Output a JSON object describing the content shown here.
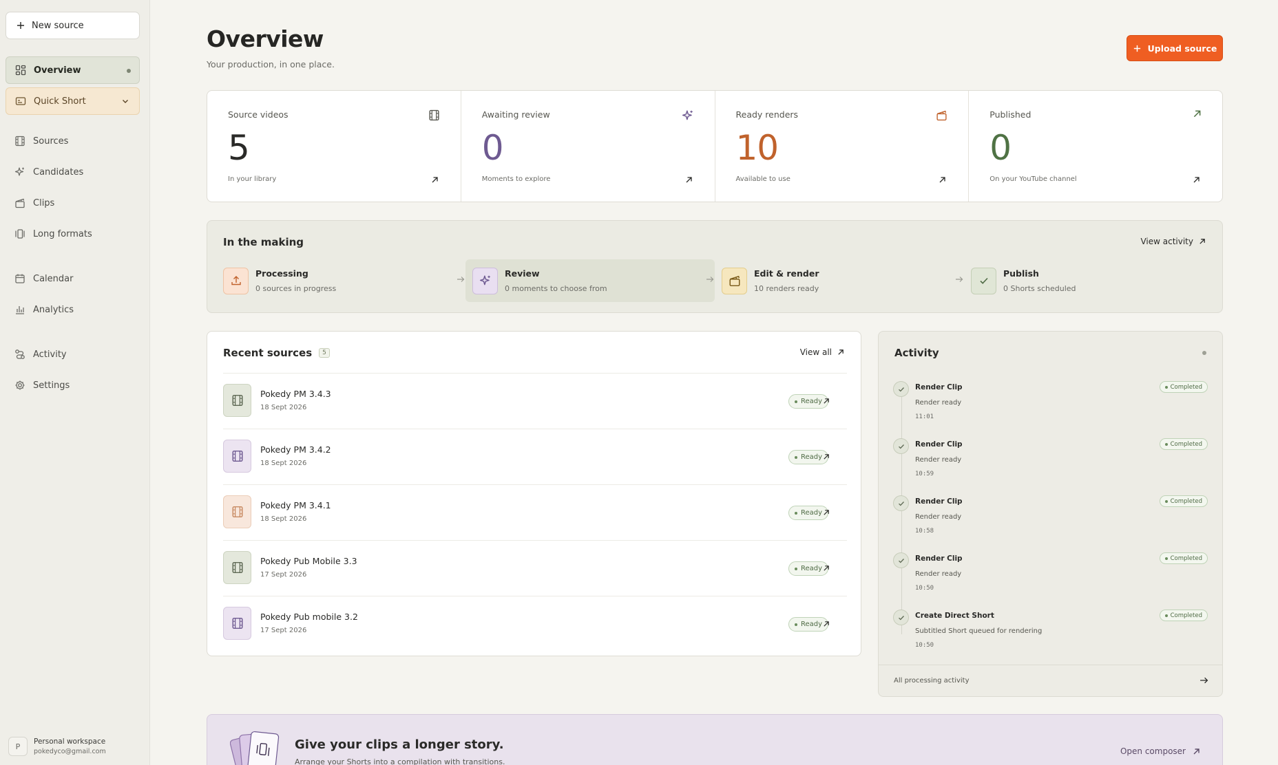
{
  "sidebar": {
    "new_source": "New source",
    "items": [
      {
        "label": "Overview"
      },
      {
        "label": "Quick Short"
      },
      {
        "label": "Sources"
      },
      {
        "label": "Candidates"
      },
      {
        "label": "Clips"
      },
      {
        "label": "Long formats"
      },
      {
        "label": "Calendar"
      },
      {
        "label": "Analytics"
      },
      {
        "label": "Activity"
      },
      {
        "label": "Settings"
      }
    ],
    "workspace": {
      "avatar": "P",
      "name": "Personal workspace",
      "email": "pokedyco@gmail.com"
    }
  },
  "header": {
    "title": "Overview",
    "subtitle": "Your production, in one place.",
    "upload_label": "Upload source"
  },
  "stats": [
    {
      "label": "Source videos",
      "value": "5",
      "sub": "In your library",
      "icon": "film-icon",
      "color": "#2a2a28"
    },
    {
      "label": "Awaiting review",
      "value": "0",
      "sub": "Moments to explore",
      "icon": "sparkle-icon",
      "color": "#6e5a91"
    },
    {
      "label": "Ready renders",
      "value": "10",
      "sub": "Available to use",
      "icon": "clapper-icon",
      "color": "#c0622c"
    },
    {
      "label": "Published",
      "value": "0",
      "sub": "On your YouTube channel",
      "icon": "arrow-up-right-icon",
      "color": "#4f7244"
    }
  ],
  "making": {
    "title": "In the making",
    "view_activity": "View activity",
    "stages": [
      {
        "title": "Processing",
        "sub": "0 sources in progress",
        "icon": "upload-icon"
      },
      {
        "title": "Review",
        "sub": "0 moments to choose from",
        "icon": "sparkle-icon"
      },
      {
        "title": "Edit & render",
        "sub": "10 renders ready",
        "icon": "clapper-icon"
      },
      {
        "title": "Publish",
        "sub": "0 Shorts scheduled",
        "icon": "check-icon"
      }
    ]
  },
  "recent": {
    "title": "Recent sources",
    "count": "5",
    "view_all": "View all",
    "items": [
      {
        "name": "Pokedy PM 3.4.3",
        "date": "18 Sept 2026",
        "status": "Ready"
      },
      {
        "name": "Pokedy PM 3.4.2",
        "date": "18 Sept 2026",
        "status": "Ready"
      },
      {
        "name": "Pokedy PM 3.4.1",
        "date": "18 Sept 2026",
        "status": "Ready"
      },
      {
        "name": "Pokedy Pub Mobile 3.3",
        "date": "17 Sept 2026",
        "status": "Ready"
      },
      {
        "name": "Pokedy Pub mobile 3.2",
        "date": "17 Sept 2026",
        "status": "Ready"
      }
    ]
  },
  "activity": {
    "title": "Activity",
    "footer": "All processing activity",
    "items": [
      {
        "name": "Render Clip",
        "desc": "Render ready",
        "time": "11:01",
        "status": "Completed"
      },
      {
        "name": "Render Clip",
        "desc": "Render ready",
        "time": "10:59",
        "status": "Completed"
      },
      {
        "name": "Render Clip",
        "desc": "Render ready",
        "time": "10:58",
        "status": "Completed"
      },
      {
        "name": "Render Clip",
        "desc": "Render ready",
        "time": "10:50",
        "status": "Completed"
      },
      {
        "name": "Create Direct Short",
        "desc": "Subtitled Short queued for rendering",
        "time": "10:50",
        "status": "Completed"
      }
    ]
  },
  "promo": {
    "title": "Give your clips a longer story.",
    "sub": "Arrange your Shorts into a compilation with transitions.",
    "link": "Open composer"
  },
  "colors": {
    "accent": "#ef5e22",
    "ready_green": "#4f6b45",
    "review_purple": "#6e5a91",
    "render_orange": "#c0622c",
    "published_green": "#4f7244"
  }
}
